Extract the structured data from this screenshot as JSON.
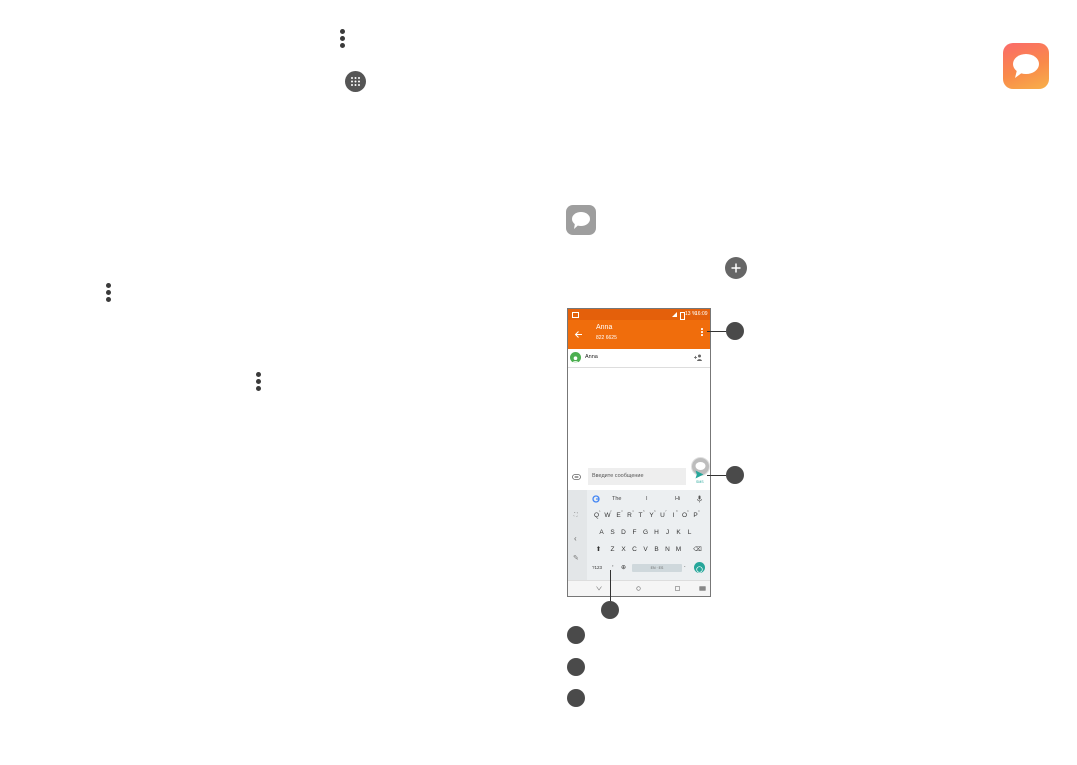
{
  "phone": {
    "status": {
      "battery": "13 %",
      "time": "16:09"
    },
    "header": {
      "name": "Anna",
      "number": "822 6625"
    },
    "recipient": {
      "name": "Anna"
    },
    "composer": {
      "placeholder": "Введите сообщение",
      "send_label": "SMS"
    },
    "keyboard": {
      "suggestions": [
        "The",
        "I",
        "Hi"
      ],
      "row1": [
        "Q",
        "W",
        "E",
        "R",
        "T",
        "Y",
        "U",
        "I",
        "O",
        "P"
      ],
      "row1_hints": [
        "1",
        "2",
        "3",
        "4",
        "5",
        "6",
        "7",
        "8",
        "9",
        "0"
      ],
      "row2": [
        "A",
        "S",
        "D",
        "F",
        "G",
        "H",
        "J",
        "K",
        "L"
      ],
      "row3": [
        "Z",
        "X",
        "C",
        "V",
        "B",
        "N",
        "M"
      ],
      "symbols_key": "?123",
      "comma": ",",
      "period": ".",
      "space_label": "EN · ES"
    }
  },
  "colors": {
    "accent": "#f06d0c",
    "status_bar": "#e4600b",
    "send": "#26a69a",
    "callout": "#4a4a4a"
  }
}
